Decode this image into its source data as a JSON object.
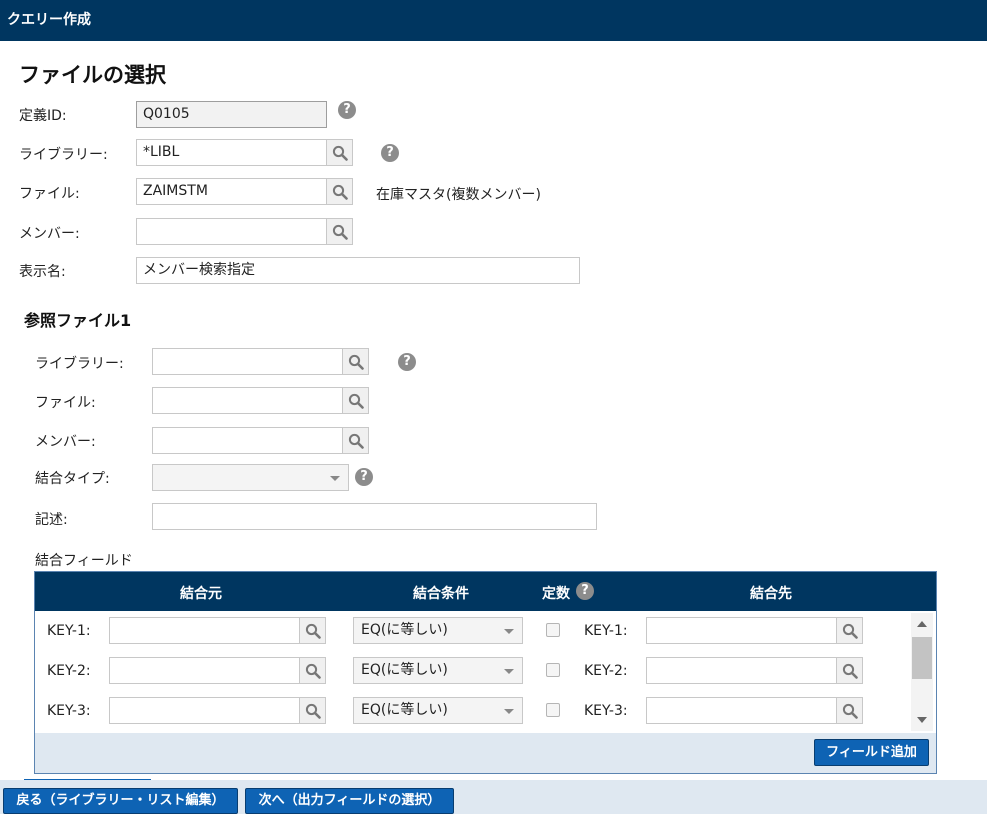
{
  "window": {
    "title": "クエリー作成"
  },
  "page": {
    "heading": "ファイルの選択"
  },
  "main_form": {
    "definition_id": {
      "label": "定義ID:",
      "value": "Q0105"
    },
    "library": {
      "label": "ライブラリー:",
      "value": "*LIBL"
    },
    "file": {
      "label": "ファイル:",
      "value": "ZAIMSTM",
      "description": "在庫マスタ(複数メンバー)"
    },
    "member": {
      "label": "メンバー:",
      "value": ""
    },
    "display_name": {
      "label": "表示名:",
      "value": "メンバー検索指定"
    }
  },
  "reference_file": {
    "heading": "参照ファイル1",
    "library": {
      "label": "ライブラリー:",
      "value": ""
    },
    "file": {
      "label": "ファイル:",
      "value": ""
    },
    "member": {
      "label": "メンバー:",
      "value": ""
    },
    "join_type": {
      "label": "結合タイプ:",
      "value": ""
    },
    "description": {
      "label": "記述:",
      "value": ""
    }
  },
  "join_fields": {
    "label": "結合フィールド",
    "columns": {
      "source": "結合元",
      "condition": "結合条件",
      "constant": "定数",
      "target": "結合先"
    },
    "rows": [
      {
        "source_key": "KEY-1:",
        "source_value": "",
        "condition": "EQ(に等しい)",
        "target_key": "KEY-1:",
        "target_value": ""
      },
      {
        "source_key": "KEY-2:",
        "source_value": "",
        "condition": "EQ(に等しい)",
        "target_key": "KEY-2:",
        "target_value": ""
      },
      {
        "source_key": "KEY-3:",
        "source_value": "",
        "condition": "EQ(に等しい)",
        "target_key": "KEY-3:",
        "target_value": ""
      }
    ],
    "add_field_label": "フィールド追加"
  },
  "footer": {
    "back_label": "戻る（ライブラリー・リスト編集）",
    "next_label": "次へ（出力フィールドの選択）"
  },
  "icons": {
    "search": "search-icon",
    "help": "help-icon",
    "dropdown": "chevron-down-icon"
  },
  "colors": {
    "header_bg": "#003660",
    "primary_button": "#0e63b4",
    "footer_bg": "#dfe8f1"
  }
}
